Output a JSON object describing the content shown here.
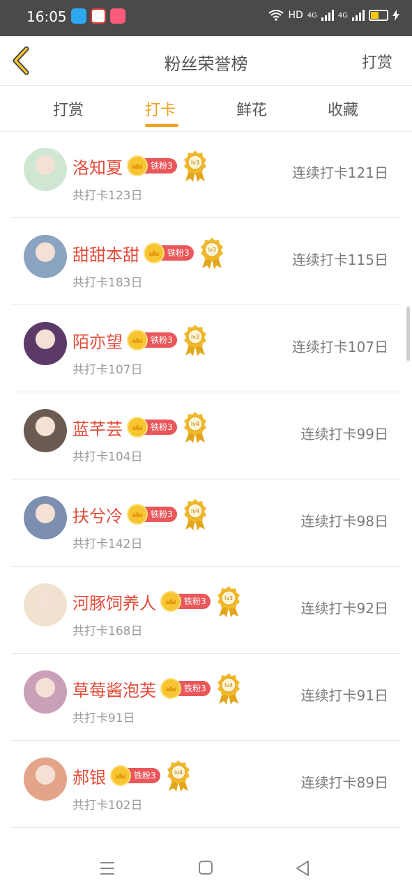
{
  "status_bar": {
    "time": "16:05",
    "network_label": "HD",
    "signal_a": "4G",
    "signal_b": "4G",
    "battery_level": 0.55,
    "app_icons": [
      "qq-icon",
      "video-app-icon",
      "bilibili-icon"
    ]
  },
  "header": {
    "title": "粉丝荣誉榜",
    "action": "打赏",
    "back_icon": "chevron-left-icon"
  },
  "tabs": [
    {
      "label": "打赏",
      "active": false
    },
    {
      "label": "打卡",
      "active": true
    },
    {
      "label": "鲜花",
      "active": false
    },
    {
      "label": "收藏",
      "active": false
    }
  ],
  "rows": [
    {
      "name": "洛知夏",
      "badge": "铁粉3",
      "medal": "lv3",
      "total": "共打卡123日",
      "streak": "连续打卡121日",
      "avatar_color": "#cfe7d2"
    },
    {
      "name": "甜甜本甜",
      "badge": "铁粉3",
      "medal": "lv3",
      "total": "共打卡183日",
      "streak": "连续打卡115日",
      "avatar_color": "#8aa3c0"
    },
    {
      "name": "陌亦望",
      "badge": "铁粉3",
      "medal": "lv3",
      "total": "共打卡107日",
      "streak": "连续打卡107日",
      "avatar_color": "#5b3a67"
    },
    {
      "name": "蓝芊芸",
      "badge": "铁粉3",
      "medal": "lv4",
      "total": "共打卡104日",
      "streak": "连续打卡99日",
      "avatar_color": "#6b5a52"
    },
    {
      "name": "扶兮冷",
      "badge": "铁粉3",
      "medal": "lv4",
      "total": "共打卡142日",
      "streak": "连续打卡98日",
      "avatar_color": "#7c8fb0"
    },
    {
      "name": "河豚饲养人",
      "badge": "铁粉3",
      "medal": "lv3",
      "total": "共打卡168日",
      "streak": "连续打卡92日",
      "avatar_color": "#f1e2cf"
    },
    {
      "name": "草莓酱泡芙",
      "badge": "铁粉3",
      "medal": "lv4",
      "total": "共打卡91日",
      "streak": "连续打卡91日",
      "avatar_color": "#c9a0b8"
    },
    {
      "name": "郝银",
      "badge": "铁粉3",
      "medal": "lv4",
      "total": "共打卡102日",
      "streak": "连续打卡89日",
      "avatar_color": "#e4a48a"
    }
  ],
  "nav_bar": {
    "icons": [
      "menu-icon",
      "home-icon",
      "back-triangle-icon"
    ]
  }
}
